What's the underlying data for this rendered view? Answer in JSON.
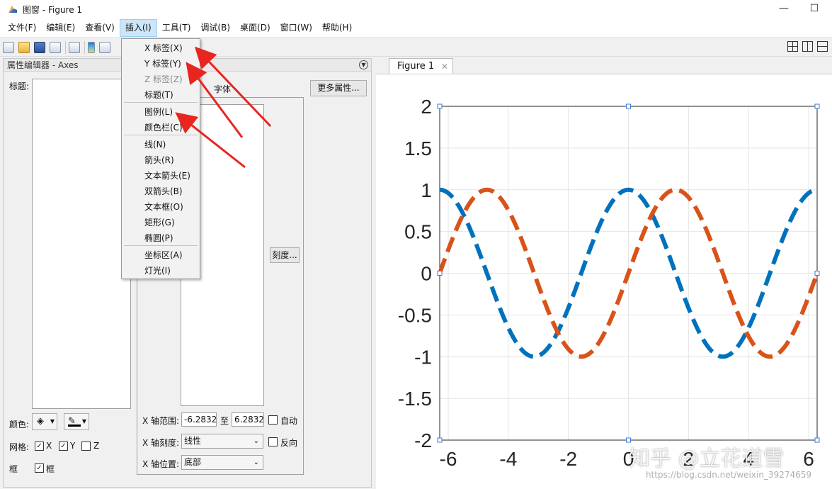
{
  "window": {
    "title": "图窗 - Figure 1",
    "minimize": "—",
    "maximize": "☐"
  },
  "menubar": {
    "items": [
      "文件(F)",
      "编辑(E)",
      "查看(V)",
      "插入(I)",
      "工具(T)",
      "调试(B)",
      "桌面(D)",
      "窗口(W)",
      "帮助(H)"
    ],
    "active_index": 3
  },
  "insert_menu": {
    "items": [
      {
        "label": "X 标签(X)",
        "enabled": true
      },
      {
        "label": "Y 标签(Y)",
        "enabled": true
      },
      {
        "label": "Z 标签(Z)",
        "enabled": false
      },
      {
        "label": "标题(T)",
        "enabled": true
      },
      {
        "label": "图例(L)",
        "enabled": true
      },
      {
        "label": "颜色栏(C)",
        "enabled": true
      },
      {
        "label": "线(N)",
        "enabled": true
      },
      {
        "label": "箭头(R)",
        "enabled": true
      },
      {
        "label": "文本箭头(E)",
        "enabled": true
      },
      {
        "label": "双箭头(B)",
        "enabled": true
      },
      {
        "label": "文本框(O)",
        "enabled": true
      },
      {
        "label": "矩形(G)",
        "enabled": true
      },
      {
        "label": "椭圆(P)",
        "enabled": true
      },
      {
        "label": "坐标区(A)",
        "enabled": true
      },
      {
        "label": "灯光(I)",
        "enabled": true
      }
    ]
  },
  "property_editor": {
    "header": "属性编辑器 - Axes",
    "title_label": "标题:",
    "font_tab": "字体",
    "more_props": "更多属性...",
    "ticks_btn": "刻度...",
    "color_label": "颜色:",
    "grid_label": "网格:",
    "grid_x": "X",
    "grid_y": "Y",
    "grid_z": "Z",
    "grid_x_checked": true,
    "grid_y_checked": true,
    "grid_z_checked": false,
    "box_label": "框",
    "box_cb_label": "框",
    "box_checked": true,
    "xrange_label": "X 轴范围:",
    "xmin": "-6.2832",
    "to": "至",
    "xmax": "6.2832",
    "auto_label": "自动",
    "xscale_label": "X 轴刻度:",
    "xscale_value": "线性",
    "reverse_label": "反向",
    "xloc_label": "X 轴位置:",
    "xloc_value": "底部"
  },
  "figure_tab": {
    "label": "Figure 1",
    "close": "✕"
  },
  "chart_data": {
    "type": "line",
    "title": "",
    "xlabel": "",
    "ylabel": "",
    "xlim": [
      -6.2832,
      6.2832
    ],
    "ylim": [
      -2,
      2
    ],
    "xticks": [
      -6,
      -4,
      -2,
      0,
      2,
      4,
      6
    ],
    "yticks": [
      2,
      1.5,
      1,
      0.5,
      0,
      -0.5,
      -1,
      -1.5,
      -2
    ],
    "grid": true,
    "series": [
      {
        "function": "cos(x)",
        "color": "#0072BD",
        "style": "dashed"
      },
      {
        "function": "sin(x)",
        "color": "#D95319",
        "style": "dashed"
      }
    ]
  },
  "watermark": {
    "text": "知乎 @立花道雪",
    "url": "https://blog.csdn.net/weixin_39274659"
  },
  "colors": {
    "menu_highlight": "#cde6f7",
    "arrow": "#e8251f"
  }
}
